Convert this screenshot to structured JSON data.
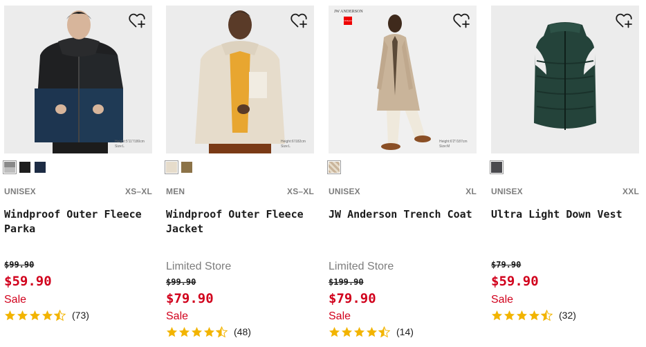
{
  "colors": {
    "price_red": "#d1001c",
    "star_gold": "#f2b400",
    "muted_gray": "#7d7d7d"
  },
  "products": [
    {
      "image_alt": "Model wearing black and navy fleece parka",
      "photo_note": [
        "Height:5'11\"/180cm",
        "Size:L"
      ],
      "swatches": [
        "#8a8a8a",
        "#1e1e1e",
        "#1d2c44"
      ],
      "gender": "UNISEX",
      "size_range": "XS–XL",
      "name": "Windproof Outer Fleece Parka",
      "store_note": "",
      "original_price": "$99.90",
      "price": "$59.90",
      "badge": "Sale",
      "rating": 4.5,
      "review_count": "(73)"
    },
    {
      "image_alt": "Model wearing cream fleece jacket",
      "photo_note": [
        "Height:6'/182cm",
        "Size:L"
      ],
      "swatches": [
        "#e6dccb",
        "#8c7348"
      ],
      "gender": "MEN",
      "size_range": "XS–XL",
      "name": "Windproof Outer Fleece Jacket",
      "store_note": "Limited Store",
      "original_price": "$99.90",
      "price": "$79.90",
      "badge": "Sale",
      "rating": 4.5,
      "review_count": "(48)"
    },
    {
      "image_alt": "Model wearing beige trench coat",
      "photo_note": [
        "Height:6'2\"/187cm",
        "Size:M"
      ],
      "logo_text": "JW ANDERSON",
      "brand_mark": "UNIQLO",
      "swatches": [
        "#c9b49a"
      ],
      "gender": "UNISEX",
      "size_range": "XL",
      "name": "JW Anderson Trench Coat",
      "store_note": "Limited Store",
      "original_price": "$199.90",
      "price": "$79.90",
      "badge": "Sale",
      "rating": 4.5,
      "review_count": "(14)"
    },
    {
      "image_alt": "Dark green ultra light down vest",
      "swatches": [
        "#4a4a4e"
      ],
      "gender": "UNISEX",
      "size_range": "XXL",
      "name": "Ultra Light Down Vest",
      "store_note": "",
      "original_price": "$79.90",
      "price": "$59.90",
      "badge": "Sale",
      "rating": 4.5,
      "review_count": "(32)"
    }
  ]
}
